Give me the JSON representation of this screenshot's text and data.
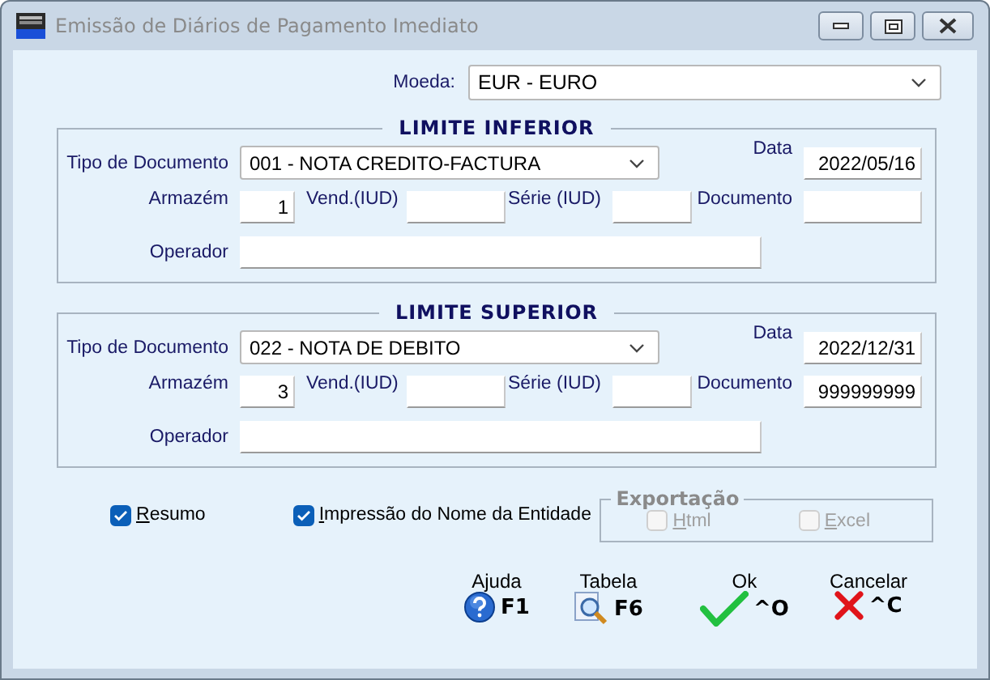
{
  "window": {
    "title": "Emissão de Diários de Pagamento Imediato"
  },
  "currency": {
    "label": "Moeda:",
    "value": "EUR - EURO"
  },
  "limits": [
    {
      "title": "LIMITE INFERIOR",
      "doc_type_label": "Tipo de Documento",
      "doc_type": "001 - NOTA CREDITO-FACTURA",
      "date_label": "Data",
      "date": "2022/05/16",
      "warehouse_label": "Armazém",
      "warehouse": "1",
      "seller_label": "Vend.(IUD)",
      "series_label": "Série (IUD)",
      "document_label": "Documento",
      "operator_label": "Operador"
    },
    {
      "title": "LIMITE SUPERIOR",
      "doc_type_label": "Tipo de Documento",
      "doc_type": "022 - NOTA DE DEBITO",
      "date_label": "Data",
      "date": "2022/12/31",
      "warehouse_label": "Armazém",
      "warehouse": "3",
      "seller_label": "Vend.(IUD)",
      "series_label": "Série (IUD)",
      "document_label": "Documento",
      "document": "999999999",
      "operator_label": "Operador"
    }
  ],
  "options": [
    {
      "label": "Resumo",
      "checked": true,
      "mnemonic": true
    },
    {
      "label": "Impressão do Nome da Entidade",
      "checked": true,
      "mnemonic": true
    }
  ],
  "export": {
    "title": "Exportação",
    "options": [
      {
        "label": "Html",
        "checked": false,
        "disabled": true,
        "mnemonic": true
      },
      {
        "label": "Excel",
        "checked": false,
        "disabled": true,
        "mnemonic": true
      }
    ]
  },
  "actions": [
    {
      "kind": "help",
      "label": "Ajuda",
      "key": "F1"
    },
    {
      "kind": "table",
      "label": "Tabela",
      "key": "F6"
    },
    {
      "kind": "ok",
      "label": "Ok",
      "key": "^O"
    },
    {
      "kind": "cancel",
      "label": "Cancelar",
      "key": "^C"
    }
  ]
}
